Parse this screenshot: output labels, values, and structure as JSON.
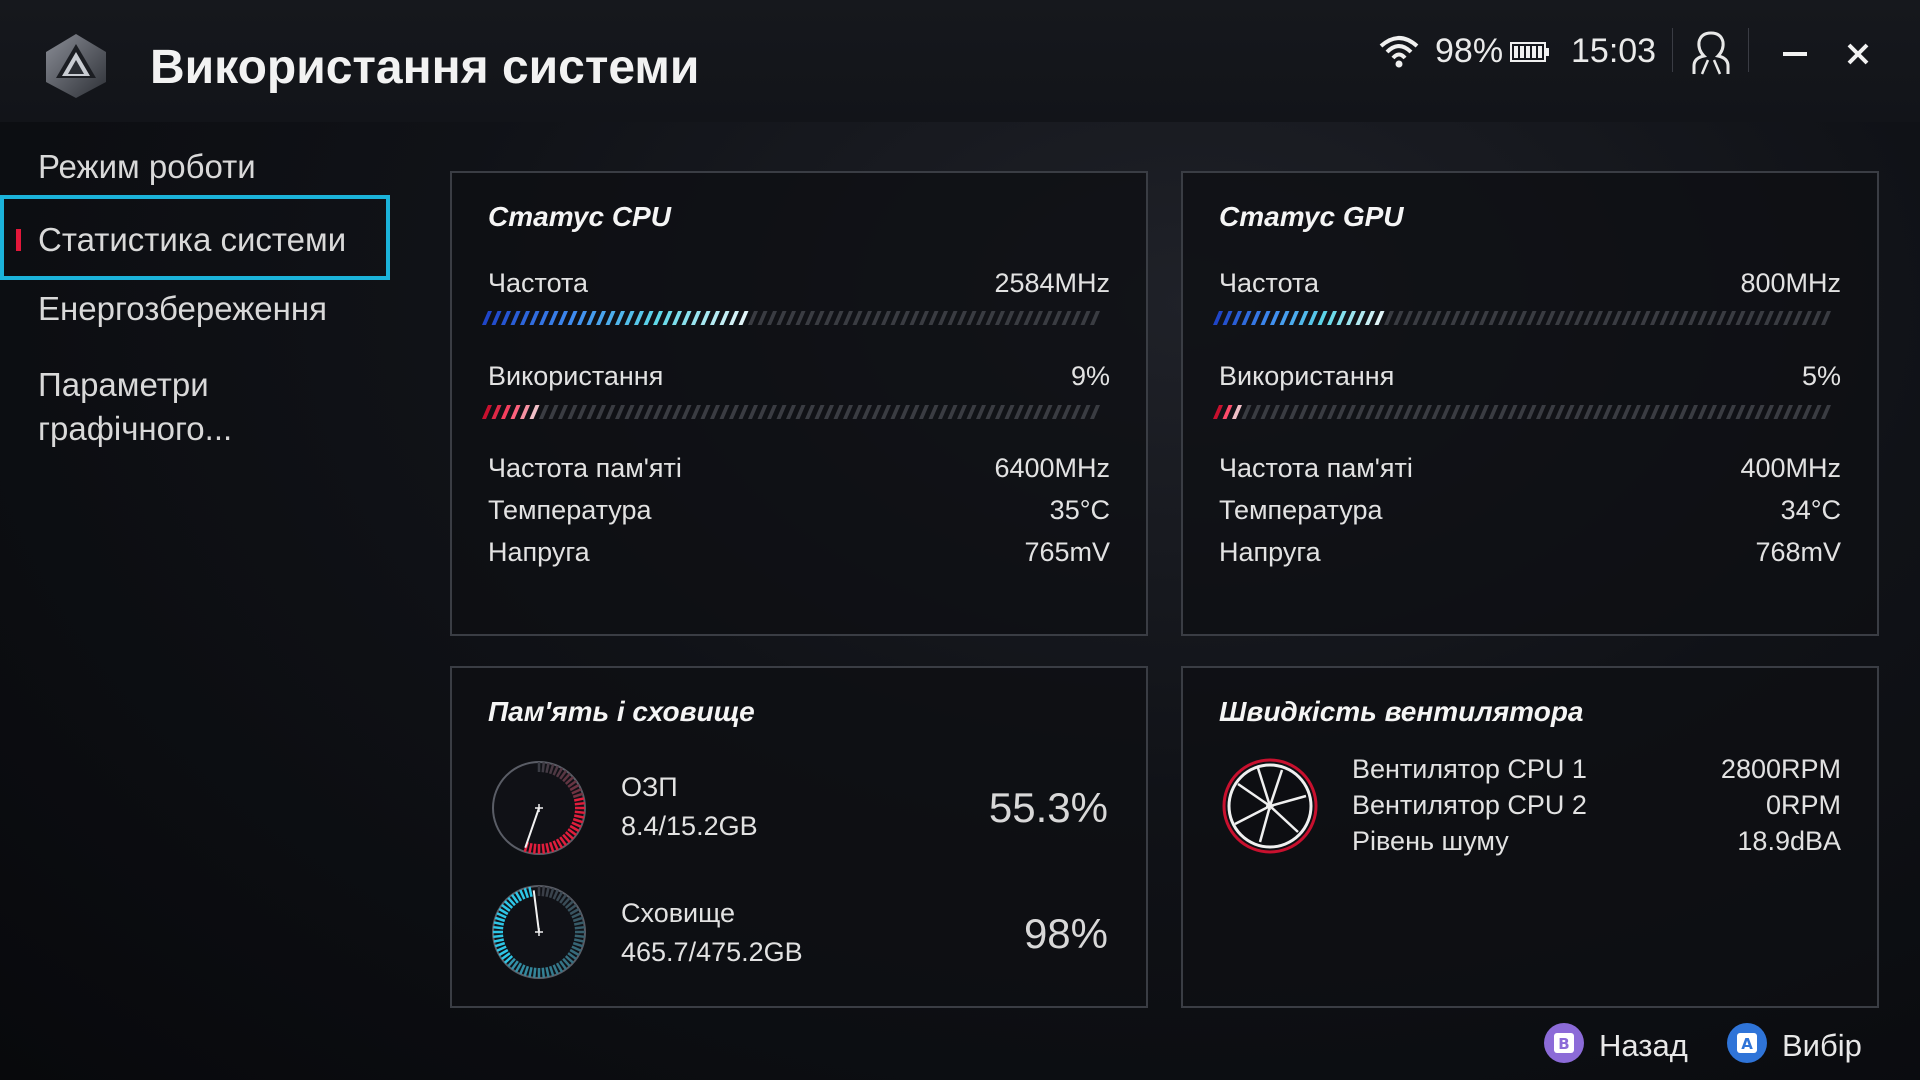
{
  "header": {
    "title": "Використання системи",
    "battery_pct": "98%",
    "clock": "15:03",
    "icons": [
      "app-logo-icon",
      "wifi-icon",
      "battery-icon",
      "user-icon",
      "minimize-icon",
      "close-icon"
    ]
  },
  "sidebar": {
    "items": [
      {
        "label": "Режим роботи"
      },
      {
        "label": "Статистика системи",
        "active": true
      },
      {
        "label": "Енергозбереження"
      },
      {
        "label": "Параметри графічного..."
      }
    ],
    "active_bar_color": "#e2173a",
    "focus_border_color": "#1bb3da"
  },
  "cpu": {
    "title": "Статус CPU",
    "freq_label": "Частота",
    "freq_value": "2584MHz",
    "freq_fraction": 0.43,
    "usage_label": "Використання",
    "usage_value": "9%",
    "usage_fraction": 0.09,
    "mem_freq_label": "Частота пам'яті",
    "mem_freq_value": "6400MHz",
    "temp_label": "Температура",
    "temp_value": "35°C",
    "volt_label": "Напруга",
    "volt_value": "765mV"
  },
  "gpu": {
    "title": "Статус GPU",
    "freq_label": "Частота",
    "freq_value": "800MHz",
    "freq_fraction": 0.27,
    "usage_label": "Використання",
    "usage_value": "5%",
    "usage_fraction": 0.05,
    "mem_freq_label": "Частота пам'яті",
    "mem_freq_value": "400MHz",
    "temp_label": "Температура",
    "temp_value": "34°C",
    "volt_label": "Напруга",
    "volt_value": "768mV"
  },
  "memory": {
    "title": "Пам'ять і сховище",
    "ram_label": "ОЗП",
    "ram_value": "8.4/15.2GB",
    "ram_pct": "55.3%",
    "ram_fraction": 0.553,
    "storage_label": "Сховище",
    "storage_value": "465.7/475.2GB",
    "storage_pct": "98%",
    "storage_fraction": 0.98
  },
  "fans": {
    "title": "Швидкість вентилятора",
    "fan1_label": "Вентилятор CPU 1",
    "fan1_value": "2800RPM",
    "fan2_label": "Вентилятор CPU 2",
    "fan2_value": "0RPM",
    "noise_label": "Рівень шуму",
    "noise_value": "18.9dBA"
  },
  "footer": {
    "back_label": "Назад",
    "back_key": "B",
    "back_color": "#8c6bd8",
    "select_label": "Вибір",
    "select_key": "A",
    "select_color": "#2f74d8"
  },
  "colors": {
    "freq_gradient": [
      "#1f45c8",
      "#3f8cf0",
      "#5fd8e8",
      "#e0f4f8"
    ],
    "usage_gradient": [
      "#c8102e",
      "#ff4b6a",
      "#f0c0c8"
    ],
    "track": "#3a3c42"
  }
}
